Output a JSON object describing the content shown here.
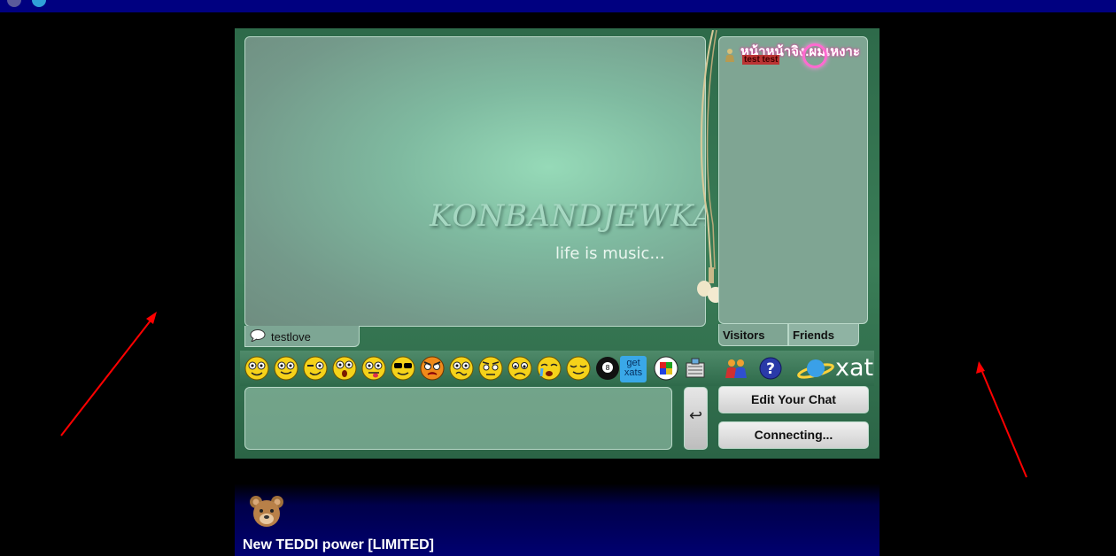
{
  "chat": {
    "background_title": "KONBANDJEWKAN",
    "background_subtitle": "life is music...",
    "current_tab_label": "testlove",
    "user": {
      "name": "หน้าหน้าจิง.ผมเหงาะ",
      "status": "test test"
    },
    "tabs": {
      "visitors": "Visitors",
      "friends": "Friends"
    },
    "get_xats_label": "get xats",
    "xat_logo_text": "xat",
    "send_glyph": "↩",
    "buttons": {
      "edit_chat": "Edit Your Chat",
      "connecting": "Connecting..."
    }
  },
  "promo": {
    "title": "New TEDDI power [LIMITED]"
  },
  "colors": {
    "chat_green": "#3a7d57",
    "top_bar": "#000080",
    "annotation_arrow": "#ff0000"
  }
}
